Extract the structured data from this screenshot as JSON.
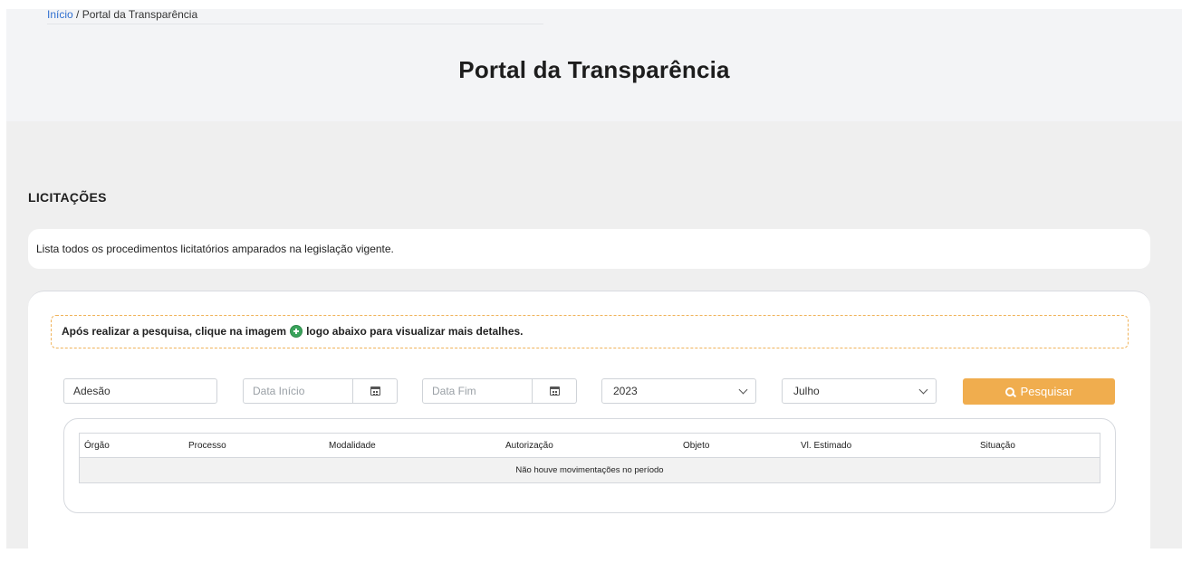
{
  "breadcrumb": {
    "home": "Início",
    "separator": "/",
    "current": "Portal da Transparência"
  },
  "page_title": "Portal da Transparência",
  "section": {
    "title": "LICITAÇÕES",
    "description": "Lista todos os procedimentos licitatórios amparados na legislação vigente."
  },
  "notice": {
    "before": "Após realizar a pesquisa, clique na imagem",
    "icon": "plus-circle-icon",
    "after": "logo abaixo para visualizar mais detalhes."
  },
  "filters": {
    "modalidade_value": "Adesão",
    "data_inicio_placeholder": "Data Início",
    "data_fim_placeholder": "Data Fim",
    "ano_selected": "2023",
    "mes_selected": "Julho",
    "search_label": "Pesquisar"
  },
  "table": {
    "columns": [
      "Órgão",
      "Processo",
      "Modalidade",
      "Autorização",
      "Objeto",
      "Vl. Estimado",
      "Situação"
    ],
    "empty_message": "Não houve movimentações no período"
  },
  "colors": {
    "accent": "#f0ad4e",
    "link": "#2f6fd0",
    "notice_border": "#f0b35a",
    "plus_icon": "#3aa35b"
  }
}
